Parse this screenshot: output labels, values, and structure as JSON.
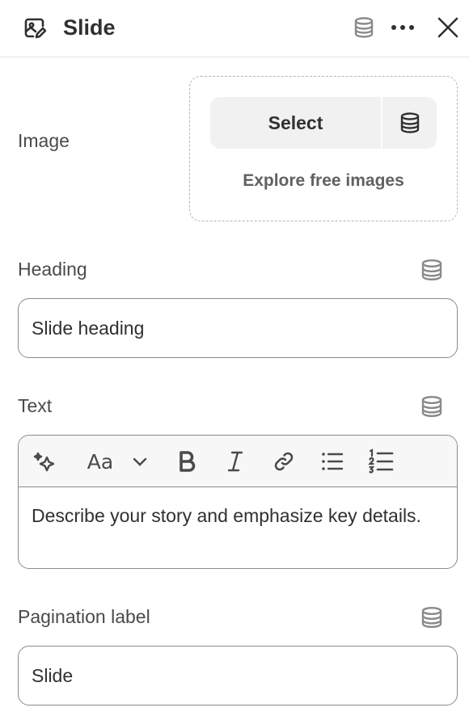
{
  "header": {
    "title": "Slide",
    "title_icon": "image-edit-icon",
    "icons": [
      "database-icon",
      "more-icon",
      "close-icon"
    ]
  },
  "image": {
    "label": "Image",
    "select_label": "Select",
    "explore_label": "Explore free images"
  },
  "heading": {
    "label": "Heading",
    "value": "Slide heading"
  },
  "text": {
    "label": "Text",
    "toolbar": [
      "magic-icon",
      "font-size-icon",
      "chevron-down-icon",
      "bold-icon",
      "italic-icon",
      "link-icon",
      "bullet-list-icon",
      "numbered-list-icon"
    ],
    "toolbar_glyphs": {
      "font": "Aa"
    },
    "value": "Describe your story and emphasize key details."
  },
  "pagination": {
    "label": "Pagination label",
    "value": "Slide"
  },
  "colors": {
    "text": "#303030",
    "muted": "#616161",
    "border": "#8a8a8a",
    "button_bg": "#f1f1f1"
  }
}
